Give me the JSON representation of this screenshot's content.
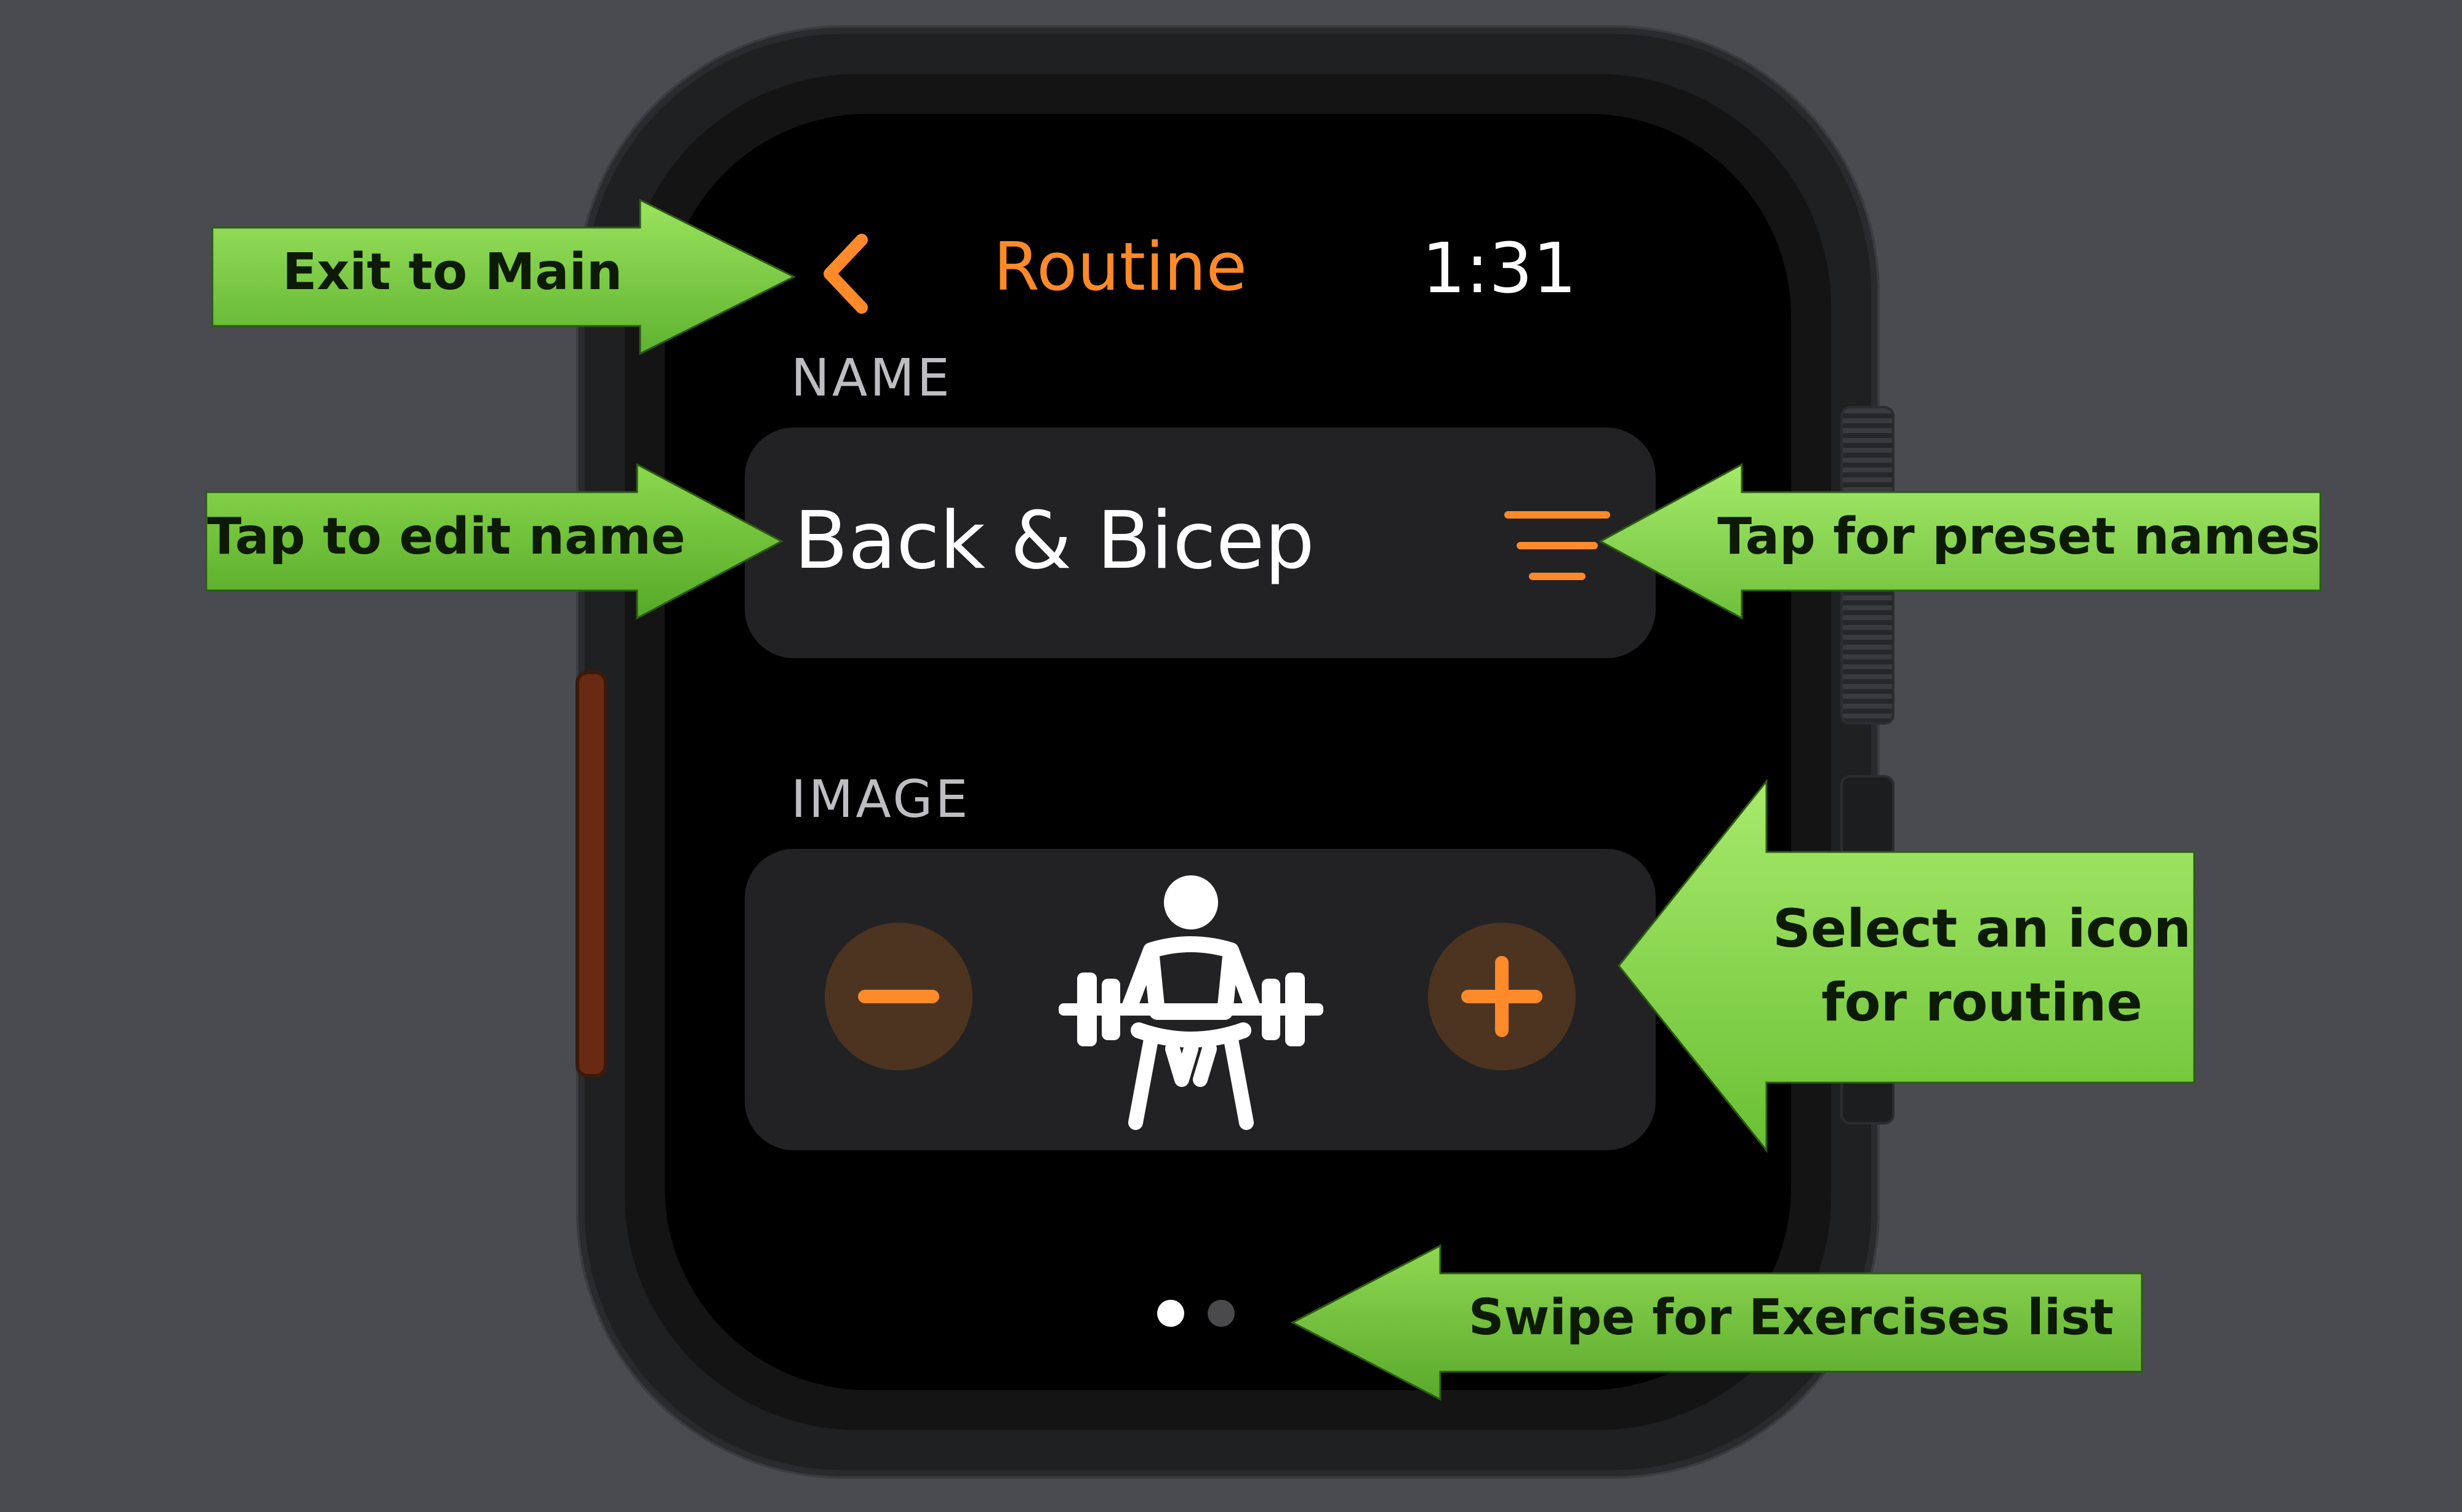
{
  "screen": {
    "title": "Routine",
    "time": "1:31",
    "name_section_label": "NAME",
    "routine_name": "Back & Bicep",
    "image_section_label": "IMAGE",
    "selected_icon": "weightlifter-barbell-icon",
    "page_indicator": {
      "current_page": 1,
      "total_pages": 2
    }
  },
  "annotations": {
    "exit": "Exit to Main",
    "edit_name": "Tap to edit name",
    "preset_names": "Tap for preset names",
    "select_icon_line1": "Select an icon",
    "select_icon_line2": "for routine",
    "swipe": "Swipe for Exercises list"
  },
  "colors": {
    "accent_orange": "#ff8a2a",
    "annotation_green": "#6cc43a",
    "background": "#4a4b51",
    "card": "#222224"
  }
}
